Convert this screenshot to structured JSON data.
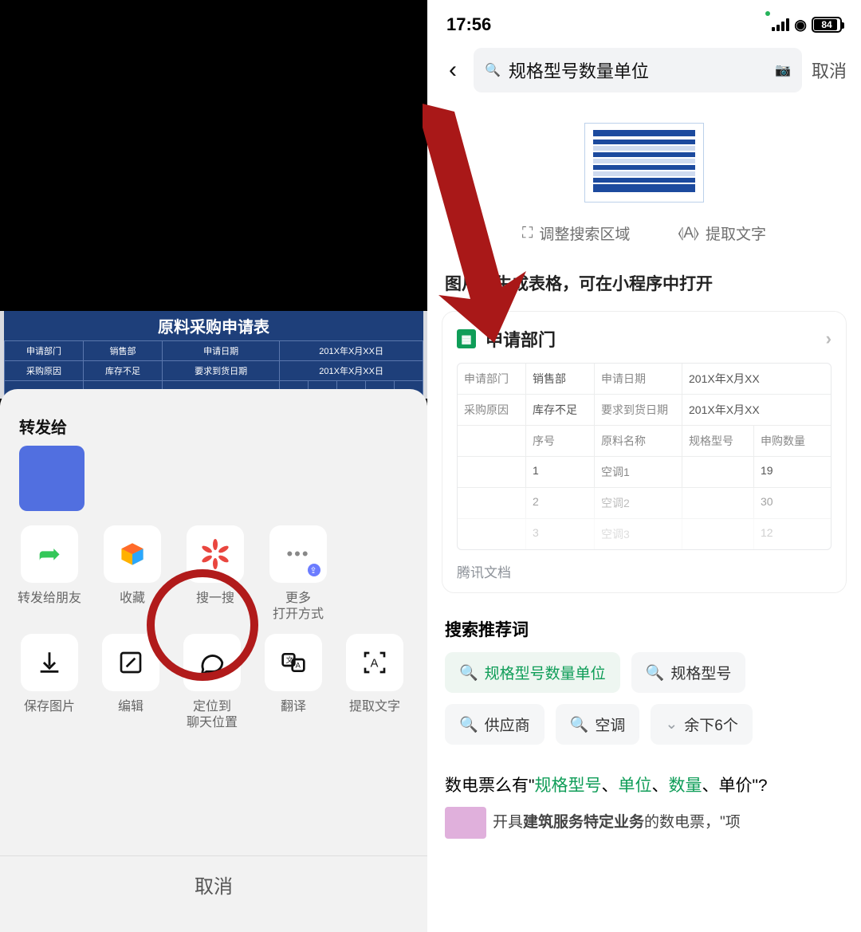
{
  "left": {
    "doc_title": "原料采购申请表",
    "doc_rows": [
      [
        "申请部门",
        "销售部",
        "申请日期",
        "201X年X月XX日"
      ],
      [
        "采购原因",
        "库存不足",
        "要求到货日期",
        "201X年X月XX日"
      ]
    ],
    "sheet": {
      "forward_label": "转发给",
      "row1": [
        {
          "label": "转发给朋友",
          "icon": "share"
        },
        {
          "label": "收藏",
          "icon": "cube"
        },
        {
          "label": "搜一搜",
          "icon": "star"
        },
        {
          "label": "更多\n打开方式",
          "icon": "dots"
        }
      ],
      "row2": [
        {
          "label": "保存图片",
          "icon": "download"
        },
        {
          "label": "编辑",
          "icon": "edit"
        },
        {
          "label": "定位到\n聊天位置",
          "icon": "chat"
        },
        {
          "label": "翻译",
          "icon": "translate"
        },
        {
          "label": "提取文字",
          "icon": "ocr"
        }
      ],
      "cancel": "取消"
    }
  },
  "right": {
    "status": {
      "time": "17:56",
      "battery": "84"
    },
    "search": {
      "query": "规格型号数量单位",
      "cancel": "取消"
    },
    "thumb_actions": {
      "crop": "调整搜索区域",
      "ocr": "提取文字"
    },
    "gen_msg": "图片已生成表格，可在小程序中打开",
    "card": {
      "title": "申请部门",
      "rows": [
        [
          "申请部门",
          "销售部",
          "申请日期",
          "201X年X月XX"
        ],
        [
          "采购原因",
          "库存不足",
          "要求到货日期",
          "201X年X月XX"
        ],
        [
          "",
          "序号",
          "原料名称",
          "规格型号",
          "申购数量"
        ],
        [
          "",
          "1",
          "空调1",
          "",
          "19"
        ],
        [
          "",
          "2",
          "空调2",
          "",
          "30"
        ],
        [
          "",
          "3",
          "空调3",
          "",
          "12"
        ]
      ],
      "footer": "腾讯文档"
    },
    "rec_title": "搜索推荐词",
    "chips": [
      "规格型号数量单位",
      "规格型号",
      "供应商",
      "空调",
      "余下6个"
    ],
    "result": {
      "line_parts": [
        "数电票么有\"",
        "规格型号",
        "、",
        "单位",
        "、",
        "数量",
        "、单价\"?"
      ],
      "sub_parts": [
        "开具",
        "建筑服务特定业务",
        "的数电票，\"项"
      ]
    }
  }
}
